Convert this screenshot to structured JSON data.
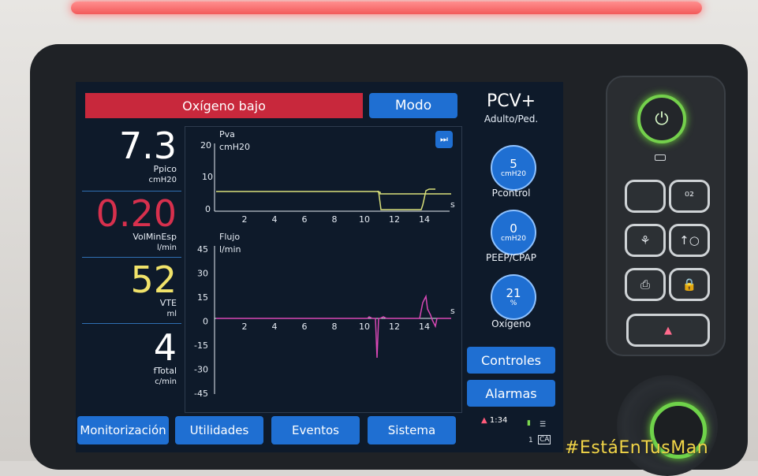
{
  "header": {
    "alarm_text": "Oxígeno bajo",
    "mode_button": "Modo",
    "mode_name": "PCV+",
    "mode_sub": "Adulto/Ped."
  },
  "values": [
    {
      "value": "7.3",
      "label": "Ppico",
      "unit": "cmH20",
      "color": "#ffffff"
    },
    {
      "value": "0.20",
      "label": "VolMinEsp",
      "unit": "l/min",
      "color": "#d7304d"
    },
    {
      "value": "52",
      "label": "VTE",
      "unit": "ml",
      "color": "#f1e36a"
    },
    {
      "value": "4",
      "label": "fTotal",
      "unit": "c/min",
      "color": "#ffffff"
    }
  ],
  "graphs": {
    "pressure": {
      "title": "Pva",
      "unit": "cmH20",
      "y_ticks": [
        "20",
        "10",
        "0"
      ],
      "x_ticks": [
        "2",
        "4",
        "6",
        "8",
        "10",
        "12",
        "14"
      ],
      "x_unit": "s"
    },
    "flow": {
      "title": "Flujo",
      "unit": "l/min",
      "y_ticks": [
        "45",
        "30",
        "15",
        "0",
        "-15",
        "-30",
        "-45"
      ],
      "x_ticks": [
        "2",
        "4",
        "6",
        "8",
        "10",
        "12",
        "14"
      ],
      "x_unit": "s"
    },
    "freeze_icon": "⏭"
  },
  "controls": [
    {
      "value": "5",
      "unit": "cmH20",
      "label": "Pcontrol"
    },
    {
      "value": "0",
      "unit": "cmH20",
      "label": "PEEP/CPAP"
    },
    {
      "value": "21",
      "unit": "%",
      "label": "Oxígeno"
    }
  ],
  "side_buttons": {
    "controles": "Controles",
    "alarmas": "Alarmas"
  },
  "tabs": [
    "Monitorización",
    "Utilidades",
    "Eventos",
    "Sistema"
  ],
  "status": {
    "time": "1:34",
    "indicator_1": "1",
    "indicator_ca": "CA"
  },
  "overlay": {
    "hashtag": "#EstáEnTusMan"
  },
  "colors": {
    "accent": "#1f6fd2",
    "alarm": "#c8283c",
    "pressure_trace": "#d9e07a",
    "flow_trace": "#d848b5",
    "power_glow": "#74d04c"
  }
}
